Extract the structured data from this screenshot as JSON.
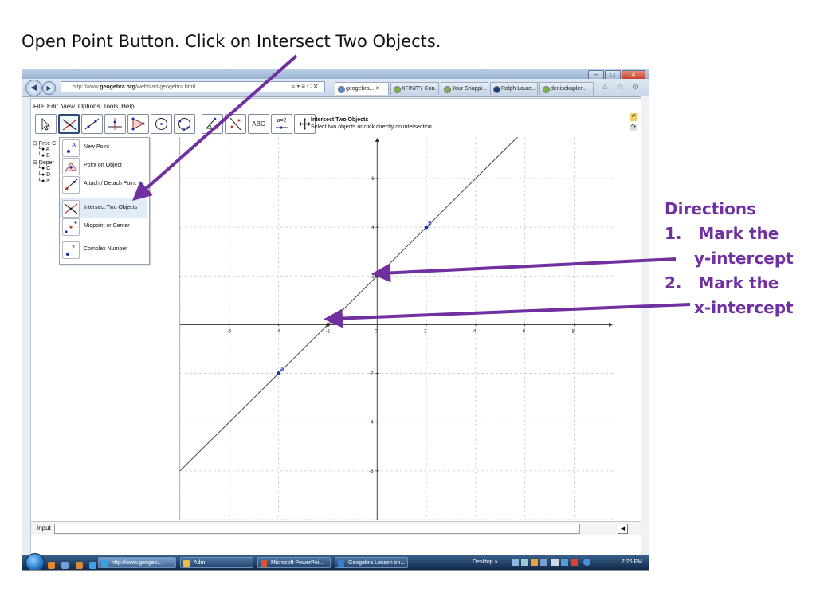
{
  "slide": {
    "title": "Open Point Button. Click on Intersect Two Objects.",
    "directions": {
      "heading": "Directions",
      "steps": [
        {
          "num": "1.",
          "line1": "Mark the",
          "line2": "y-intercept"
        },
        {
          "num": "2.",
          "line1": "Mark the",
          "line2": "x-intercept"
        }
      ]
    },
    "arrow_color": "#7030a0"
  },
  "browser": {
    "address_prefix": "http://www.",
    "address_domain": "geogebra.org",
    "address_suffix": "/webstart/geogebra.html",
    "address_tools": "⌕ ▾ ≡ C ✕",
    "tabs": [
      {
        "label": "geogebra... ✕",
        "active": true
      },
      {
        "label": "XFINITY Con...",
        "active": false
      },
      {
        "label": "Your Shoppi...",
        "active": false
      },
      {
        "label": "Ralph Laure...",
        "active": false
      },
      {
        "label": "denisekapler...",
        "active": false
      }
    ],
    "nav_icons": "⌂ ☆ ⚙"
  },
  "geogebra": {
    "menu": [
      "File",
      "Edit",
      "View",
      "Options",
      "Tools",
      "Help"
    ],
    "tool_text_label": "ABC",
    "tool_slider_label": "a=2",
    "tool_info": {
      "title": "Intersect Two Objects",
      "description": "Select two objects or click directly on intersection"
    },
    "algebra_rows": [
      "⊟ Free C",
      "└● A",
      "└● B",
      "⊟ Deper",
      "└● C",
      "└● D",
      "└● a:"
    ],
    "point_menu": [
      {
        "label": "New Point",
        "icon": "new-point-icon",
        "highlight": false
      },
      {
        "label": "Point on Object",
        "icon": "point-on-object-icon",
        "highlight": false
      },
      {
        "label": "Attach / Detach Point",
        "icon": "attach-detach-point-icon",
        "highlight": false
      },
      {
        "label": "Intersect Two Objects",
        "icon": "intersect-two-objects-icon",
        "highlight": true
      },
      {
        "label": "Midpoint or Center",
        "icon": "midpoint-icon",
        "highlight": false
      },
      {
        "label": "Complex Number",
        "icon": "complex-number-icon",
        "highlight": false
      }
    ],
    "input_label": "Input"
  },
  "chart_data": {
    "type": "line",
    "x_ticks": [
      "-6",
      "-4",
      "-2",
      "0",
      "2",
      "4",
      "6",
      "8"
    ],
    "y_ticks": [
      "6",
      "4",
      "2",
      "-2",
      "-4",
      "-6"
    ],
    "x_tick_values": [
      -6,
      -4,
      -2,
      0,
      2,
      4,
      6,
      8
    ],
    "y_tick_values": [
      6,
      4,
      2,
      -2,
      -4,
      -6
    ],
    "xlim": [
      -8,
      9.6
    ],
    "ylim": [
      -8,
      7.7
    ],
    "grid": true,
    "line": {
      "slope": 1,
      "intercept": 2
    },
    "points": [
      {
        "label": "A",
        "x": -4,
        "y": -2,
        "color": "#1a2fc0"
      },
      {
        "label": "B",
        "x": 2,
        "y": 4,
        "color": "#1a2fc0"
      },
      {
        "label": "C",
        "x": 0,
        "y": 2,
        "color": "#333333"
      },
      {
        "label": "D",
        "x": -2,
        "y": 0,
        "color": "#333333"
      }
    ]
  },
  "taskbar": {
    "items": [
      {
        "label": "http://www.geogeb...",
        "color": "#3aa0e8",
        "active": true
      },
      {
        "label": "Adm",
        "color": "#e8c040",
        "active": false
      },
      {
        "label": "Microsoft PowerPoi...",
        "color": "#d9532b",
        "active": false
      },
      {
        "label": "Geogebra Lesson on...",
        "color": "#3b7fd0",
        "active": false
      }
    ],
    "desktop_label": "Desktop »",
    "clock": "7:26 PM"
  }
}
